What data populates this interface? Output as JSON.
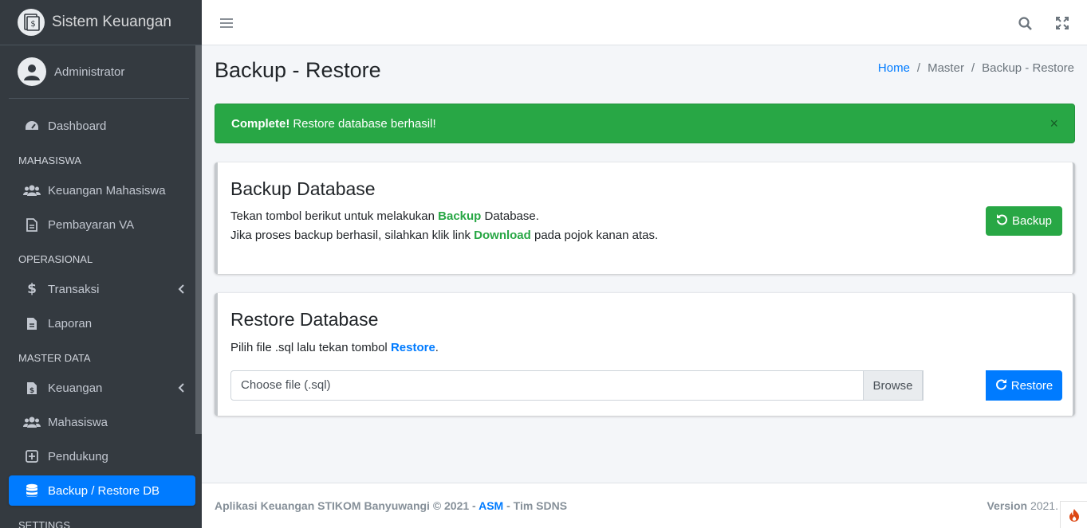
{
  "brand": {
    "name": "Sistem Keuangan",
    "logo_icon": "finance-doc-icon"
  },
  "user": {
    "name": "Administrator",
    "avatar_icon": "user-avatar-icon"
  },
  "sidebar": {
    "items": [
      {
        "type": "item",
        "label": "Dashboard",
        "icon": "tachometer-icon"
      },
      {
        "type": "header",
        "label": "MAHASISWA"
      },
      {
        "type": "item",
        "label": "Keuangan Mahasiswa",
        "icon": "users-icon"
      },
      {
        "type": "item",
        "label": "Pembayaran VA",
        "icon": "file-icon"
      },
      {
        "type": "header",
        "label": "OPERASIONAL"
      },
      {
        "type": "item",
        "label": "Transaksi",
        "icon": "dollar-icon",
        "has_arrow": true
      },
      {
        "type": "item",
        "label": "Laporan",
        "icon": "file-icon"
      },
      {
        "type": "header",
        "label": "MASTER DATA"
      },
      {
        "type": "item",
        "label": "Keuangan",
        "icon": "file-invoice-dollar-icon",
        "has_arrow": true
      },
      {
        "type": "item",
        "label": "Mahasiswa",
        "icon": "users-icon"
      },
      {
        "type": "item",
        "label": "Pendukung",
        "icon": "plus-square-icon"
      },
      {
        "type": "item",
        "label": "Backup / Restore DB",
        "icon": "database-icon",
        "active": true
      },
      {
        "type": "header",
        "label": "SETTINGS"
      }
    ]
  },
  "topbar": {
    "menu_icon": "hamburger-icon",
    "search_icon": "search-icon",
    "fullscreen_icon": "expand-icon"
  },
  "page": {
    "title": "Backup - Restore",
    "breadcrumb": [
      "Home",
      "Master",
      "Backup - Restore"
    ]
  },
  "alert": {
    "strong": "Complete!",
    "message": "Restore database berhasil!",
    "close": "×"
  },
  "backup_card": {
    "title": "Backup Database",
    "line1_pre": "Tekan tombol berikut untuk melakukan ",
    "line1_em": "Backup",
    "line1_post": " Database.",
    "line2_pre": "Jika proses backup berhasil, silahkan klik link ",
    "line2_em": "Download",
    "line2_post": " pada pojok kanan atas.",
    "button": "Backup"
  },
  "restore_card": {
    "title": "Restore Database",
    "line_pre": "Pilih file .sql lalu tekan tombol ",
    "line_em": "Restore",
    "line_post": ".",
    "file_placeholder": "Choose file (.sql)",
    "browse": "Browse",
    "button": "Restore"
  },
  "footer": {
    "left_pre": "Aplikasi Keuangan STIKOM Banyuwangi © 2021 - ",
    "left_link": "ASM",
    "left_post": " - Tim SDNS",
    "version_label": "Version",
    "version_value": "2021."
  },
  "colors": {
    "sidebar": "#343a40",
    "primary": "#007bff",
    "success": "#28a745"
  }
}
